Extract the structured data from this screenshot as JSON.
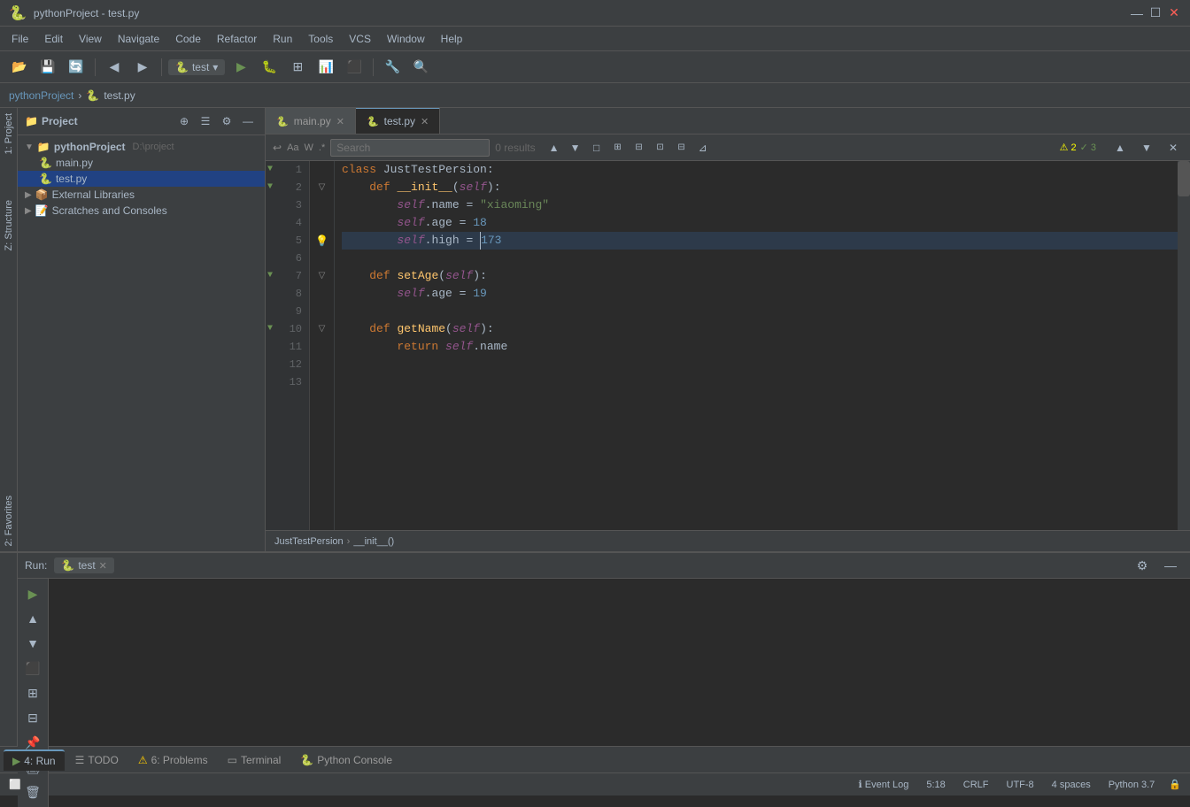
{
  "app": {
    "title": "pythonProject - test.py",
    "icon": "🐍"
  },
  "titlebar": {
    "title": "pythonProject - test.py",
    "min": "—",
    "max": "☐",
    "close": "✕"
  },
  "menubar": {
    "items": [
      "File",
      "Edit",
      "View",
      "Navigate",
      "Code",
      "Refactor",
      "Run",
      "Tools",
      "VCS",
      "Window",
      "Help"
    ]
  },
  "toolbar": {
    "run_config": "test",
    "buttons": [
      "open",
      "save",
      "refresh",
      "back",
      "forward",
      "run",
      "debug",
      "coverage",
      "profile",
      "stop",
      "wrench",
      "search"
    ]
  },
  "breadcrumb": {
    "project": "pythonProject",
    "file": "test.py"
  },
  "sidebar": {
    "project_label": "Project",
    "root": "pythonProject",
    "root_path": "D:\\project",
    "items": [
      {
        "name": "main.py",
        "type": "python",
        "indent": 1
      },
      {
        "name": "test.py",
        "type": "python",
        "indent": 1,
        "selected": true
      },
      {
        "name": "External Libraries",
        "type": "folder",
        "indent": 0
      },
      {
        "name": "Scratches and Consoles",
        "type": "scratches",
        "indent": 0
      }
    ]
  },
  "tabs": [
    {
      "name": "main.py",
      "active": false
    },
    {
      "name": "test.py",
      "active": true
    }
  ],
  "search": {
    "placeholder": "Search",
    "results": "0 results"
  },
  "code": {
    "lines": [
      {
        "num": 1,
        "text": "class JustTestPersion:",
        "tokens": [
          {
            "t": "kw",
            "v": "class "
          },
          {
            "t": "cn",
            "v": "JustTestPersion"
          },
          {
            "t": "cn",
            "v": ":"
          }
        ]
      },
      {
        "num": 2,
        "text": "    def __init__(self):",
        "tokens": [
          {
            "t": "cn",
            "v": "    "
          },
          {
            "t": "kw",
            "v": "def "
          },
          {
            "t": "fn",
            "v": "__init__"
          },
          {
            "t": "cn",
            "v": "("
          },
          {
            "t": "self-kw",
            "v": "self"
          },
          {
            "t": "cn",
            "v": "):"
          }
        ]
      },
      {
        "num": 3,
        "text": "        self.name = \"xiaoming\"",
        "tokens": [
          {
            "t": "cn",
            "v": "        "
          },
          {
            "t": "self-kw",
            "v": "self"
          },
          {
            "t": "cn",
            "v": ".name = "
          },
          {
            "t": "st",
            "v": "\"xiaoming\""
          }
        ]
      },
      {
        "num": 4,
        "text": "        self.age = 18",
        "tokens": [
          {
            "t": "cn",
            "v": "        "
          },
          {
            "t": "self-kw",
            "v": "self"
          },
          {
            "t": "cn",
            "v": ".age = "
          },
          {
            "t": "nm",
            "v": "18"
          }
        ]
      },
      {
        "num": 5,
        "text": "        self.high = 173",
        "tokens": [
          {
            "t": "cn",
            "v": "        "
          },
          {
            "t": "self-kw",
            "v": "self"
          },
          {
            "t": "cn",
            "v": ".high = "
          },
          {
            "t": "nm",
            "v": "173"
          }
        ],
        "bulb": true
      },
      {
        "num": 6,
        "text": "",
        "tokens": []
      },
      {
        "num": 7,
        "text": "    def setAge(self):",
        "tokens": [
          {
            "t": "cn",
            "v": "    "
          },
          {
            "t": "kw",
            "v": "def "
          },
          {
            "t": "fn",
            "v": "setAge"
          },
          {
            "t": "cn",
            "v": "("
          },
          {
            "t": "self-kw",
            "v": "self"
          },
          {
            "t": "cn",
            "v": "):"
          }
        ]
      },
      {
        "num": 8,
        "text": "        self.age = 19",
        "tokens": [
          {
            "t": "cn",
            "v": "        "
          },
          {
            "t": "self-kw",
            "v": "self"
          },
          {
            "t": "cn",
            "v": ".age = "
          },
          {
            "t": "nm",
            "v": "19"
          }
        ]
      },
      {
        "num": 9,
        "text": "",
        "tokens": []
      },
      {
        "num": 10,
        "text": "    def getName(self):",
        "tokens": [
          {
            "t": "cn",
            "v": "    "
          },
          {
            "t": "kw",
            "v": "def "
          },
          {
            "t": "fn",
            "v": "getName"
          },
          {
            "t": "cn",
            "v": "("
          },
          {
            "t": "self-kw",
            "v": "self"
          },
          {
            "t": "cn",
            "v": "):"
          }
        ]
      },
      {
        "num": 11,
        "text": "        return self.name",
        "tokens": [
          {
            "t": "cn",
            "v": "        "
          },
          {
            "t": "kw",
            "v": "return "
          },
          {
            "t": "self-kw",
            "v": "self"
          },
          {
            "t": "cn",
            "v": ".name"
          }
        ]
      },
      {
        "num": 12,
        "text": "",
        "tokens": []
      },
      {
        "num": 13,
        "text": "",
        "tokens": []
      }
    ]
  },
  "editor_status": {
    "breadcrumb": "JustTestPersion > __init__()",
    "warnings": "⚠ 2",
    "checks": "✓ 3"
  },
  "bottom_panel": {
    "run_label": "Run:",
    "run_tab": "test",
    "settings_icon": "⚙",
    "close_icon": "—"
  },
  "bottom_tabs": [
    {
      "name": "4: Run",
      "active": true,
      "icon": "▶"
    },
    {
      "name": "TODO",
      "active": false,
      "icon": "☰"
    },
    {
      "name": "6: Problems",
      "active": false,
      "icon": "⚠"
    },
    {
      "name": "Terminal",
      "active": false,
      "icon": "▭"
    },
    {
      "name": "Python Console",
      "active": false,
      "icon": "🐍"
    }
  ],
  "bottom_toolbar_btns": [
    "▶",
    "↑",
    "↓",
    "⬛",
    "⊞",
    "⊟",
    "📌",
    "🖨",
    "🗑"
  ],
  "status_bar": {
    "position": "5:18",
    "line_ending": "CRLF",
    "encoding": "UTF-8",
    "indent": "4 spaces",
    "interpreter": "Python 3.7",
    "lock_icon": "🔒",
    "event_log": "Event Log"
  },
  "left_panel_tabs": [
    {
      "name": "1: Project"
    },
    {
      "name": "Z: Structure"
    },
    {
      "name": "2: Favorites"
    }
  ],
  "cursor": {
    "line": 5,
    "col": 18
  }
}
